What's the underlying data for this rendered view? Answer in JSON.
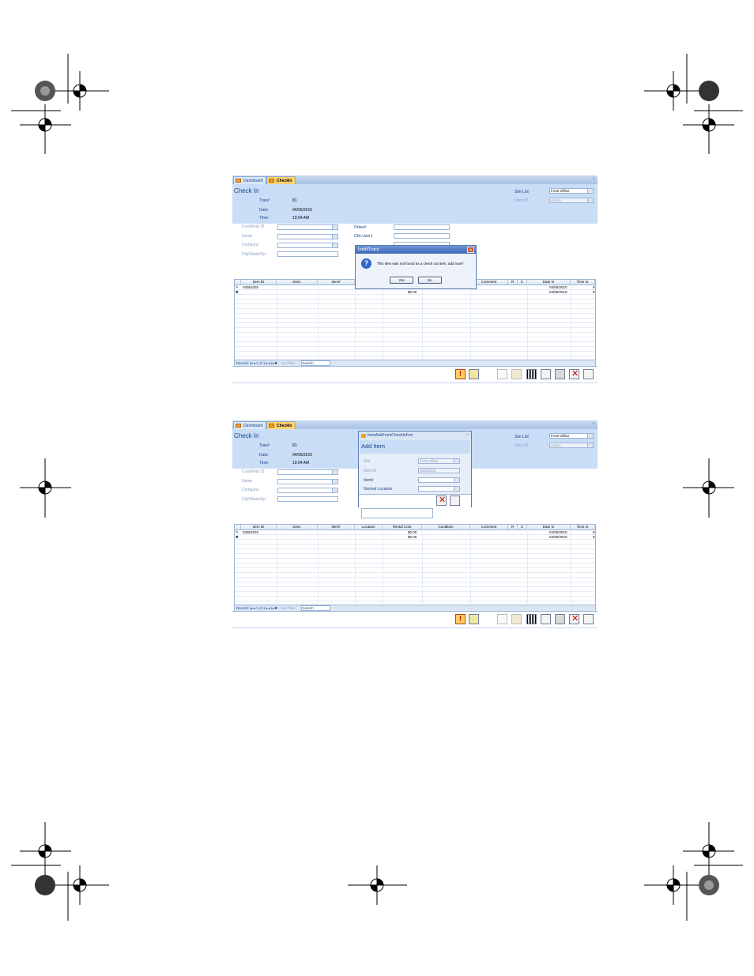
{
  "colors": {
    "header_bg": "#c9ddf6",
    "accent_tab": "#ffd26b",
    "label": "#15428b"
  },
  "tabs": [
    {
      "label": "Dashboard",
      "icon": "dashboard-icon"
    },
    {
      "label": "CheckIn",
      "icon": "form-icon"
    }
  ],
  "form": {
    "title": "Check In",
    "trans_label": "Tran#",
    "trans_value": "81",
    "date_label": "Date:",
    "date_value": "04/05/2010",
    "time_label": "Time:",
    "time_value": "10:04 AM",
    "site_label": "Site List",
    "site_value": "Front Office",
    "user_label": "User ID",
    "user_value": "Admin",
    "left_fields": [
      "Cust/Emp ID",
      "Name",
      "Company",
      "City/State/Zip"
    ],
    "right_fields": [
      "Order#",
      "Chk User1",
      "Chk User2",
      "Chk User3"
    ]
  },
  "grid": {
    "columns": [
      "Item ID",
      "Desc",
      "Item#",
      "Location",
      "Rental Cost",
      "Condition",
      "Comment",
      "R",
      "C",
      "Date In",
      "Time In"
    ],
    "rows": [
      {
        "item_id": "04051002",
        "rental_cost": "$0.00",
        "date_in": "04/05/2010",
        "time_in": "9"
      },
      {
        "item_id": "",
        "rental_cost": "$0.00",
        "date_in": "04/05/2010",
        "time_in": "9"
      }
    ],
    "nav": {
      "record_label": "Record:",
      "position": "1 of 1",
      "filter": "No Filter",
      "search": "Search"
    }
  },
  "dialog1": {
    "title": "IntelliTrack",
    "message": "This item was not found as a check out item, add now?",
    "yes": "Yes",
    "no": "No"
  },
  "dialog2": {
    "window_title": "ItemAddFromCheckInFrm",
    "heading": "Add Item",
    "fields": [
      {
        "label": "Site",
        "value": "Front Office"
      },
      {
        "label": "Item ID",
        "value": "04051002"
      },
      {
        "label": "Item#",
        "value": ""
      },
      {
        "label": "Normal Location",
        "value": ""
      }
    ]
  },
  "toolbar_icons": [
    "alert-icon",
    "binoculars-icon",
    "clock-icon",
    "stop-icon",
    "barcode-icon",
    "preview-icon",
    "print-icon",
    "close-icon",
    "exit-icon"
  ]
}
